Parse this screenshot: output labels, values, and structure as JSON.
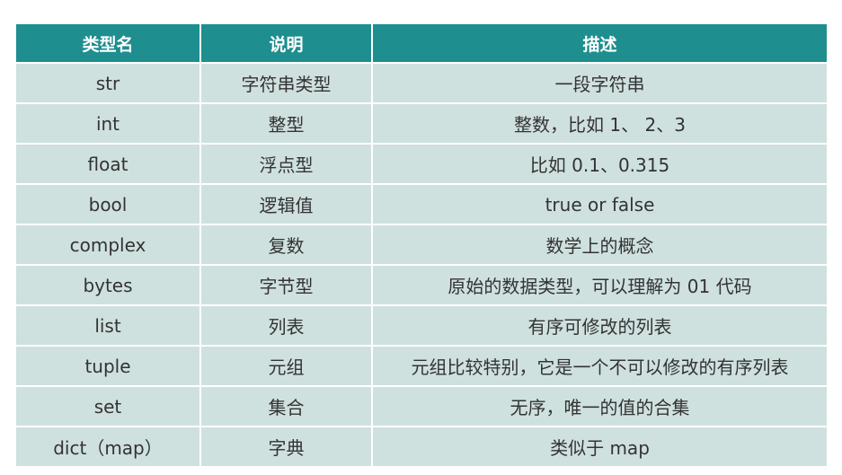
{
  "table": {
    "headers": [
      "类型名",
      "说明",
      "描述"
    ],
    "rows": [
      [
        "str",
        "字符串类型",
        "一段字符串"
      ],
      [
        "int",
        "整型",
        "整数，比如 1、 2、3"
      ],
      [
        "float",
        "浮点型",
        "比如 0.1、0.315"
      ],
      [
        "bool",
        "逻辑值",
        "true or false"
      ],
      [
        "complex",
        "复数",
        "数学上的概念"
      ],
      [
        "bytes",
        "字节型",
        "原始的数据类型，可以理解为 01 代码"
      ],
      [
        "list",
        "列表",
        "有序可修改的列表"
      ],
      [
        "tuple",
        "元组",
        "元组比较特别，它是一个不可以修改的有序列表"
      ],
      [
        "set",
        "集合",
        "无序，唯一的值的合集"
      ],
      [
        "dict（map）",
        "字典",
        "类似于 map"
      ]
    ]
  },
  "colors": {
    "header_bg": "#1e8e8f",
    "header_text": "#ffffff",
    "row_bg": "#cfe1df",
    "row_text": "#333333",
    "border": "#ffffff"
  }
}
